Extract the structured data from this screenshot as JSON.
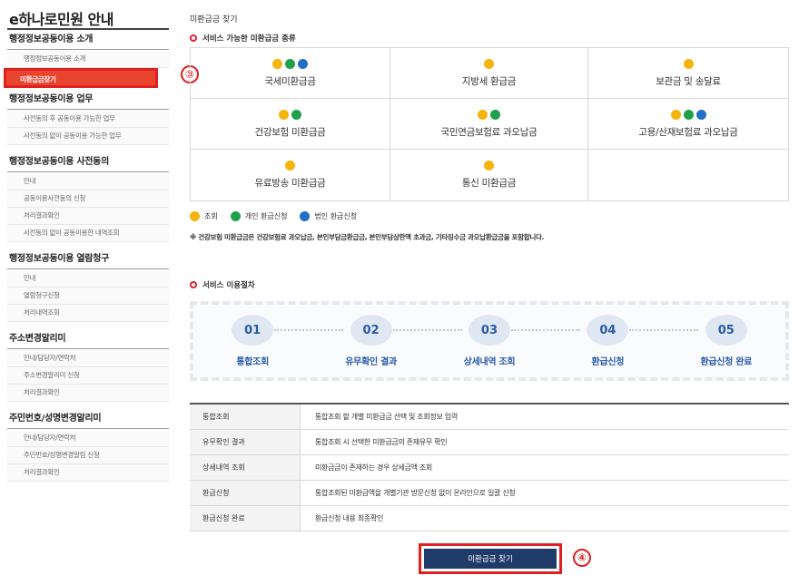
{
  "sidebar": {
    "title": "e하나로민원 안내",
    "sections": [
      {
        "title": "행정정보공동이용 소개",
        "items": [
          "행정정보공동이용 소개",
          "미환급금찾기"
        ]
      },
      {
        "title": "행정정보공동이용 업무",
        "items": [
          "사전동의 후 공동이용 가능한 업무",
          "사전동의 없이 공동이용 가능한 업무"
        ]
      },
      {
        "title": "행정정보공동이용 사전동의",
        "items": [
          "안내",
          "공동이용사전동의 신청",
          "처리결과확인",
          "사전동의 없이 공동이용한 내역조회"
        ]
      },
      {
        "title": "행정정보공동이용 열람청구",
        "items": [
          "안내",
          "열람청구신청",
          "처리내역조회"
        ]
      },
      {
        "title": "주소변경알리미",
        "items": [
          "안내/담당자/연락처",
          "주소변경알리미 신청",
          "처리결과확인"
        ]
      },
      {
        "title": "주민번호/성명변경알리미",
        "items": [
          "안내/담당자/연락처",
          "주민번호/성명변경알림 신청",
          "처리결과확인"
        ]
      }
    ]
  },
  "markers": {
    "sidebar_marker": "③",
    "button_marker": "④"
  },
  "main": {
    "heading": "미환급금 찾기",
    "types_label": "서비스 가능한 미환급금 종류",
    "types": [
      {
        "label": "국세미환급금",
        "dots": [
          "yellow",
          "green",
          "blue"
        ]
      },
      {
        "label": "지방세 환급금",
        "dots": [
          "yellow"
        ]
      },
      {
        "label": "보관금 및 송달료",
        "dots": [
          "yellow"
        ]
      },
      {
        "label": "건강보험 미환급금",
        "dots": [
          "yellow",
          "green"
        ]
      },
      {
        "label": "국민연금보험료 과오납금",
        "dots": [
          "yellow",
          "green"
        ]
      },
      {
        "label": "고용/산재보험료 과오납금",
        "dots": [
          "yellow",
          "green",
          "blue"
        ]
      },
      {
        "label": "유료방송 미환급금",
        "dots": [
          "yellow"
        ]
      },
      {
        "label": "통신 미환급금",
        "dots": [
          "yellow"
        ]
      },
      {
        "label": "",
        "dots": []
      }
    ],
    "legend": [
      {
        "color": "yellow",
        "label": "조회"
      },
      {
        "color": "green",
        "label": "개인 환급신청"
      },
      {
        "color": "blue",
        "label": "법인 환급신청"
      }
    ],
    "note": "※ 건강보험 미환급금은 건강보험료 과오납금, 본인부담금환급금, 본인부담상한액 초과금, 기타징수금 과오납환급금을 포함합니다.",
    "process_label": "서비스 이용절차",
    "steps": [
      {
        "num": "01",
        "label": "통합조회"
      },
      {
        "num": "02",
        "label": "유무확인 결과"
      },
      {
        "num": "03",
        "label": "상세내역 조회"
      },
      {
        "num": "04",
        "label": "환급신청"
      },
      {
        "num": "05",
        "label": "환급신청 완료"
      }
    ],
    "table": [
      {
        "head": "통합조회",
        "desc": "통합조회 할 개별 미환급금 선택 및 조회정보 입력"
      },
      {
        "head": "유무확인 결과",
        "desc": "통합조회 시 선택한 미환급금의 존재유무 확인"
      },
      {
        "head": "상세내역 조회",
        "desc": "미환급금이 존재하는 경우 상세금액 조회"
      },
      {
        "head": "환급신청",
        "desc": "통합조회된 미환급액을 개별기관 방문신청 없이 온라인으로 일괄 신청"
      },
      {
        "head": "환급신청 완료",
        "desc": "환급신청 내용 최종확인"
      }
    ],
    "find_button": "미환급금 찾기"
  },
  "colors": {
    "yellow": "#f5b40a",
    "green": "#1fa04a",
    "blue": "#1f6fc6",
    "active_red": "#e8452f",
    "button_navy": "#1f3b6a"
  }
}
